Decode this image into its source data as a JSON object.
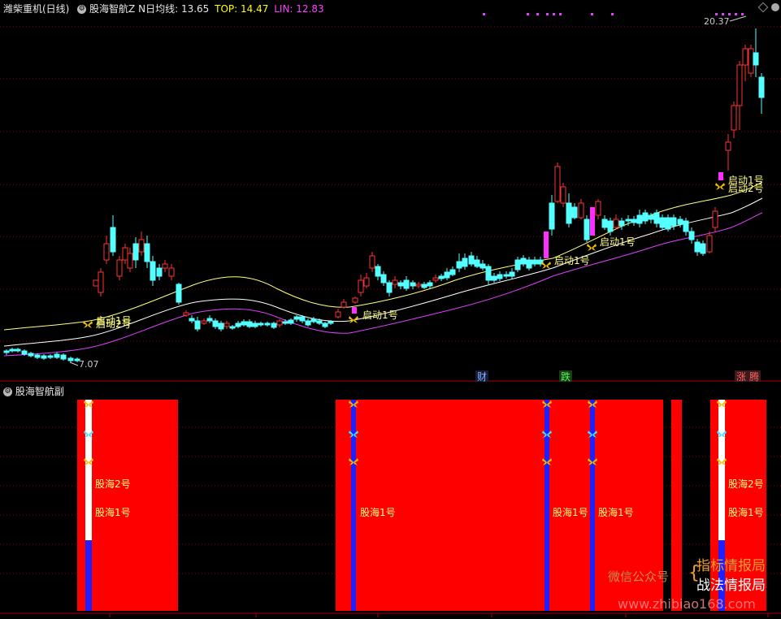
{
  "header": {
    "stock_name": "潍柴重机(日线)",
    "indicator_name": "股海智航Z",
    "avg_label": "N日均线:",
    "avg_value": "13.65",
    "top_label": "TOP:",
    "top_value": "14.47",
    "lin_label": "LIN:",
    "lin_value": "12.83"
  },
  "sub_panel": {
    "title": "股海智航副"
  },
  "price_labels": {
    "high": "20.37",
    "low": "7.07"
  },
  "signals": {
    "qidong1": "启动1号",
    "qidong2": "启动2号",
    "guhai1": "股海1号",
    "guhai2": "股海2号"
  },
  "markers": {
    "cai": "财",
    "die": "跌",
    "zhang": "涨",
    "teng": "腾"
  },
  "watermark": {
    "public_account": "微信公众号",
    "line1": "指标情报局",
    "line2": "战法情报局",
    "site": "www.zhibiao168.com"
  },
  "colors": {
    "up": "#ff3232",
    "down": "#54ffff",
    "avg_line": "#ffff80",
    "lin_line": "#e040ff",
    "panel_red": "#ff0000",
    "panel_blue": "#2020ff"
  },
  "icons": {
    "settings": "gear-icon",
    "signal": "butterfly-icon"
  },
  "chart_data": {
    "type": "candlestick",
    "high_label": 20.37,
    "low_label": 7.07
  }
}
